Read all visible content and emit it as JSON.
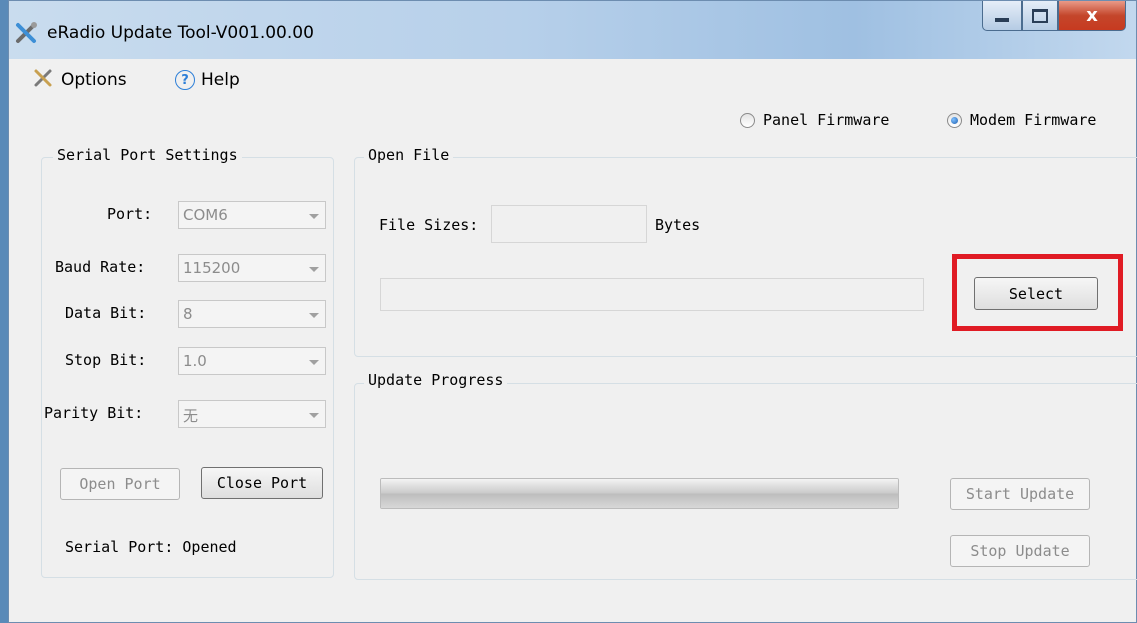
{
  "window": {
    "title": "eRadio Update Tool-V001.00.00",
    "close_glyph": "x"
  },
  "menu": {
    "options_label": "Options",
    "help_label": "Help",
    "help_glyph": "?"
  },
  "firmware_mode": {
    "panel_label": "Panel Firmware",
    "modem_label": "Modem Firmware",
    "selected": "Modem Firmware"
  },
  "serial": {
    "group_title": "Serial Port Settings",
    "port": {
      "label": "Port:",
      "value": "COM6"
    },
    "baud_rate": {
      "label": "Baud Rate:",
      "value": "115200"
    },
    "data_bit": {
      "label": "Data Bit:",
      "value": "8"
    },
    "stop_bit": {
      "label": "Stop Bit:",
      "value": "1.0"
    },
    "parity_bit": {
      "label": "Parity Bit:",
      "value": "无"
    },
    "open_port_label": "Open Port",
    "close_port_label": "Close Port",
    "status_text": "Serial Port: Opened"
  },
  "open_file": {
    "group_title": "Open File",
    "file_sizes_label": "File Sizes:",
    "file_size_value": "",
    "bytes_label": "Bytes",
    "file_path_value": "",
    "select_label": "Select"
  },
  "update": {
    "group_title": "Update Progress",
    "progress_fraction": 1.0,
    "start_label": "Start Update",
    "stop_label": "Stop Update"
  },
  "colors": {
    "highlight": "#e01b24",
    "accent": "#1e5fb0"
  }
}
